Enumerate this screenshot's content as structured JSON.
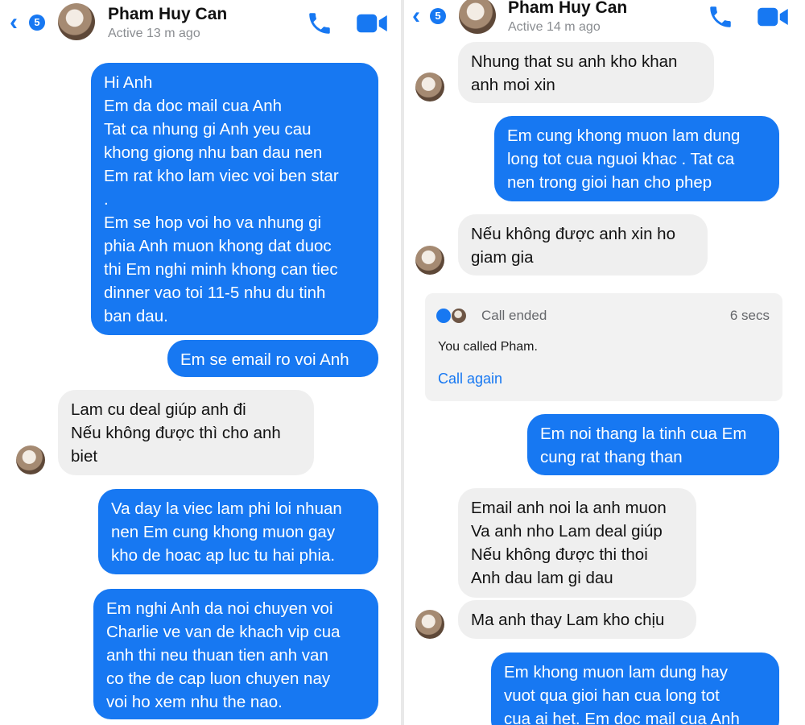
{
  "colors": {
    "accent": "#1778f2",
    "outgoing_bubble": "#1778f2",
    "incoming_bubble": "#efefef"
  },
  "left": {
    "header": {
      "badge": "5",
      "name": "Pham Huy Can",
      "status": "Active 13 m ago"
    },
    "messages": [
      "Hi Anh\nEm da doc mail cua Anh\nTat ca nhung gi Anh yeu cau\nkhong giong nhu ban dau nen\nEm rat kho lam viec voi ben star\n.\nEm se hop voi ho va nhung gi\nphia Anh muon khong dat duoc\nthi Em nghi minh khong can tiec\ndinner vao toi 11-5 nhu du tinh\nban dau.",
      "Em se email ro voi Anh",
      "Lam cu deal giúp anh đi\nNếu không được thì cho anh\nbiet",
      "Va day la viec lam phi loi nhuan\nnen Em cung khong muon gay\nkho de hoac ap luc tu hai phia.",
      "Em nghi Anh da noi chuyen voi\nCharlie ve van de khach vip cua\nanh thi neu thuan tien anh van\nco the de cap luon chuyen nay\nvoi ho xem nhu the nao."
    ]
  },
  "right": {
    "header": {
      "badge": "5",
      "name": "Pham Huy Can",
      "status": "Active 14 m ago"
    },
    "messages": [
      "Nhung that su anh kho khan\nanh moi xin",
      "Em cung khong muon lam dung\nlong tot cua nguoi khac . Tat ca\nnen trong gioi han cho phep",
      "Nếu không được anh xin ho\ngiam gia",
      "Em noi thang la tinh cua Em\ncung rat thang than",
      "Email anh noi la anh muon\nVa anh nho Lam deal giúp\nNếu không được thi thoi\nAnh dau lam gi dau",
      "Ma anh thay Lam kho chịu",
      "Em khong muon lam dung hay\nvuot qua gioi han cua long tot\ncua ai het. Em doc mail cua Anh"
    ],
    "call": {
      "title": "Call ended",
      "duration": "6 secs",
      "description": "You called Pham.",
      "action": "Call again"
    }
  }
}
